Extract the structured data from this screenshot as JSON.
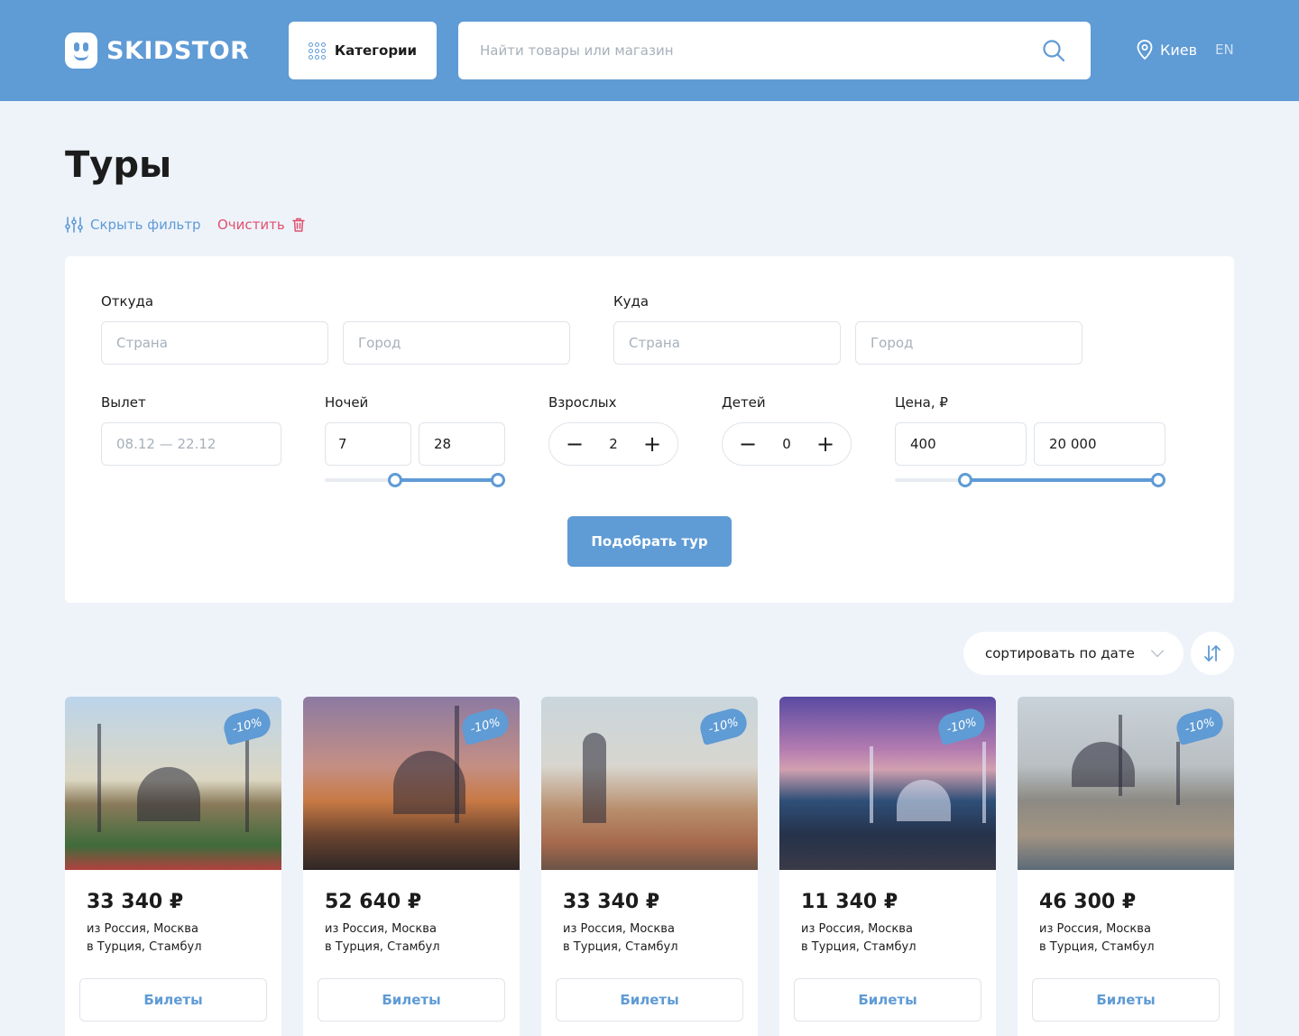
{
  "header": {
    "logo_text": "SKIDSTOR",
    "categories_label": "Категории",
    "search_placeholder": "Найти товары или магазин",
    "city": "Киев",
    "lang": "EN"
  },
  "page": {
    "title": "Туры",
    "hide_filter": "Скрыть фильтр",
    "clear": "Очистить"
  },
  "filter": {
    "from_label": "Откуда",
    "to_label": "Куда",
    "country_placeholder": "Страна",
    "city_placeholder": "Город",
    "departure_label": "Вылет",
    "departure_placeholder": "08.12 — 22.12",
    "nights_label": "Ночей",
    "nights_min": "7",
    "nights_max": "28",
    "adults_label": "Взрослых",
    "adults_value": "2",
    "children_label": "Детей",
    "children_value": "0",
    "price_label": "Цена,  ₽",
    "price_min": "400",
    "price_max": "20 000",
    "submit": "Подобрать тур"
  },
  "sort": {
    "label": "сортировать по дате"
  },
  "cards": [
    {
      "price": "33 340 ₽",
      "from": "из Россия, Москва",
      "to": "в Турция, Стамбул",
      "discount": "-10%",
      "button": "Билеты"
    },
    {
      "price": "52 640 ₽",
      "from": "из Россия, Москва",
      "to": "в Турция, Стамбул",
      "discount": "-10%",
      "button": "Билеты"
    },
    {
      "price": "33 340 ₽",
      "from": "из Россия, Москва",
      "to": "в Турция, Стамбул",
      "discount": "-10%",
      "button": "Билеты"
    },
    {
      "price": "11 340 ₽",
      "from": "из Россия, Москва",
      "to": "в Турция, Стамбул",
      "discount": "-10%",
      "button": "Билеты"
    },
    {
      "price": "46 300 ₽",
      "from": "из Россия, Москва",
      "to": "в Турция, Стамбул",
      "discount": "-10%",
      "button": "Билеты"
    }
  ],
  "colors": {
    "brand": "#5f9bd5",
    "danger": "#e2516e",
    "background": "#eef3fa"
  }
}
